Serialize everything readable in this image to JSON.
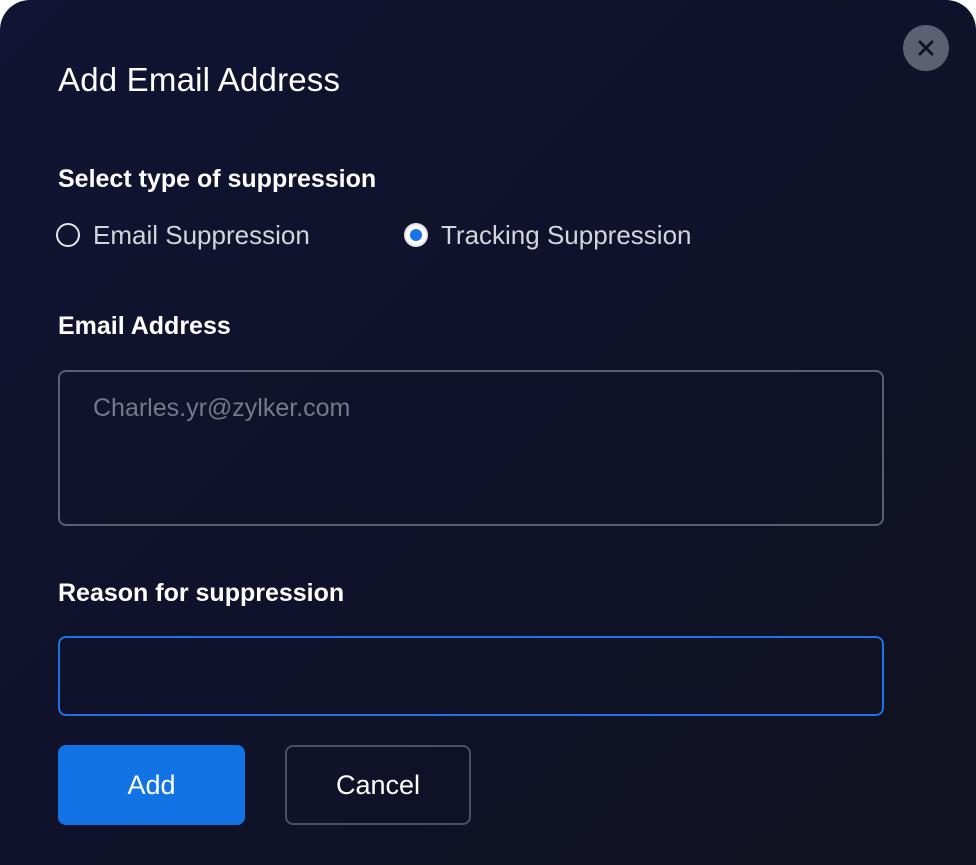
{
  "dialog": {
    "title": "Add Email Address",
    "close_label": "x"
  },
  "suppression_type": {
    "label": "Select type of suppression",
    "options": [
      {
        "label": "Email Suppression",
        "selected": false
      },
      {
        "label": "Tracking Suppression",
        "selected": true
      }
    ]
  },
  "email": {
    "label": "Email Address",
    "value": "",
    "placeholder": "Charles.yr@zylker.com"
  },
  "reason": {
    "label": "Reason for suppression",
    "value": ""
  },
  "actions": {
    "add_label": "Add",
    "cancel_label": "Cancel"
  },
  "colors": {
    "background": "#111432",
    "accent": "#1273e5",
    "focus_border": "#1b74e4",
    "close_button": "#5d6072"
  },
  "icons": {
    "close": "close-icon"
  }
}
